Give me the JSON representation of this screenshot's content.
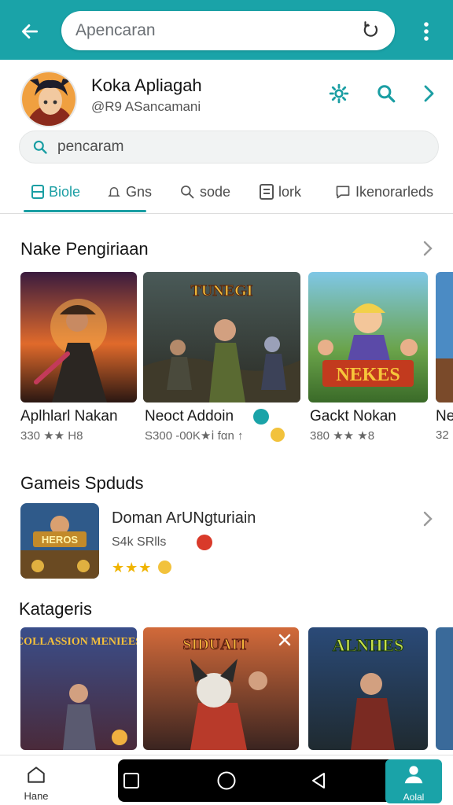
{
  "topbar": {
    "search_text": "Apencaran",
    "accent": "#1aa3a8"
  },
  "profile": {
    "name": "Koka Apliagah",
    "subtitle": "@R9 ASancamani"
  },
  "search2": {
    "text": "pencaram"
  },
  "tabs": [
    {
      "label": "Biole",
      "icon": "grid-icon",
      "active": true
    },
    {
      "label": "Gns",
      "icon": "bell-icon"
    },
    {
      "label": "sode",
      "icon": "search-icon"
    },
    {
      "label": "lork",
      "icon": "document-icon"
    },
    {
      "label": "Ikenorarleds",
      "icon": "chat-icon"
    }
  ],
  "section1": {
    "title": "Nake Pengiriaan",
    "cards": [
      {
        "title": "Aplhlarl Nakan",
        "meta": "330 ★★ H8"
      },
      {
        "title": "Neoct Addoin",
        "meta": "S300 -00K★ⅰ fαn ↑"
      },
      {
        "title": "Gackt Nokan",
        "meta": "380 ★★ ★8"
      },
      {
        "title": "Ne",
        "meta": "32"
      }
    ],
    "card_art_titles": [
      "",
      "TUNEGI",
      "NEKES",
      ""
    ]
  },
  "section2": {
    "title": "Gameis Spduds",
    "item": {
      "title": "Doman ArUNgturiain",
      "meta": "S4k SRlls",
      "stars": "★★★",
      "thumb_label": "HEROS"
    }
  },
  "section3": {
    "title": "Katageris",
    "cards": [
      {
        "art_title": "COLLASSION MENIEES"
      },
      {
        "art_title": "SIDUAIT"
      },
      {
        "art_title": "ALNHES"
      },
      {
        "art_title": ""
      }
    ]
  },
  "bottom_nav": {
    "home_label": "Hane",
    "account_label": "Aolal"
  }
}
